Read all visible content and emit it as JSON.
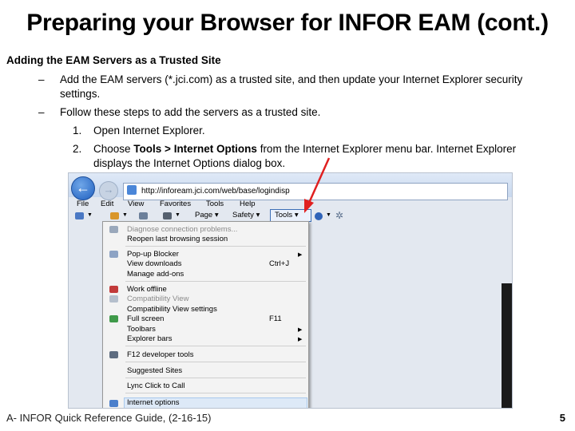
{
  "title": "Preparing your Browser for INFOR EAM (cont.)",
  "heading": "Adding the EAM Servers as a Trusted Site",
  "bullets": [
    {
      "dash": "–",
      "line1": "Add the EAM servers (*.jci.com) as a trusted site, and then update your Internet Explorer security",
      "line2": "settings."
    },
    {
      "dash": "–",
      "line1": "Follow these steps to add the servers as a trusted site."
    }
  ],
  "steps": [
    {
      "num": "1.",
      "text": "Open Internet Explorer."
    },
    {
      "num": "2.",
      "pre": "Choose ",
      "bold1": "Tools",
      "mid": " > ",
      "bold2": "Internet Options",
      "post": " from the Internet Explorer menu bar. Internet Explorer",
      "line2": "displays the Internet Options dialog box."
    }
  ],
  "screenshot": {
    "url": "http://infoream.jci.com/web/base/logindisp",
    "menubar": [
      "File",
      "Edit",
      "View",
      "Favorites",
      "Tools",
      "Help"
    ],
    "cmdbar": {
      "page": "Page ▾",
      "safety": "Safety ▾",
      "tools": "Tools ▾"
    },
    "menu_items": [
      {
        "label": "Diagnose connection problems...",
        "disabled": true
      },
      {
        "label": "Reopen last browsing session"
      },
      {
        "label": "Pop-up Blocker",
        "submenu": true
      },
      {
        "label": "View downloads",
        "shortcut": "Ctrl+J"
      },
      {
        "label": "Manage add-ons"
      },
      {
        "label": "Work offline"
      },
      {
        "label": "Compatibility View",
        "disabled": true
      },
      {
        "label": "Compatibility View settings"
      },
      {
        "label": "Full screen",
        "shortcut": "F11"
      },
      {
        "label": "Toolbars",
        "submenu": true
      },
      {
        "label": "Explorer bars",
        "submenu": true
      },
      {
        "label": "F12 developer tools"
      },
      {
        "label": "Suggested Sites"
      },
      {
        "label": "Lync Click to Call"
      },
      {
        "label": "Internet options"
      }
    ],
    "colors": {
      "highlight": "#dde9f7",
      "arrow": "#e02020",
      "back_button": "#1f5fbf"
    }
  },
  "footer": "A- INFOR Quick Reference Guide, (2-16-15)",
  "page_number": "5"
}
